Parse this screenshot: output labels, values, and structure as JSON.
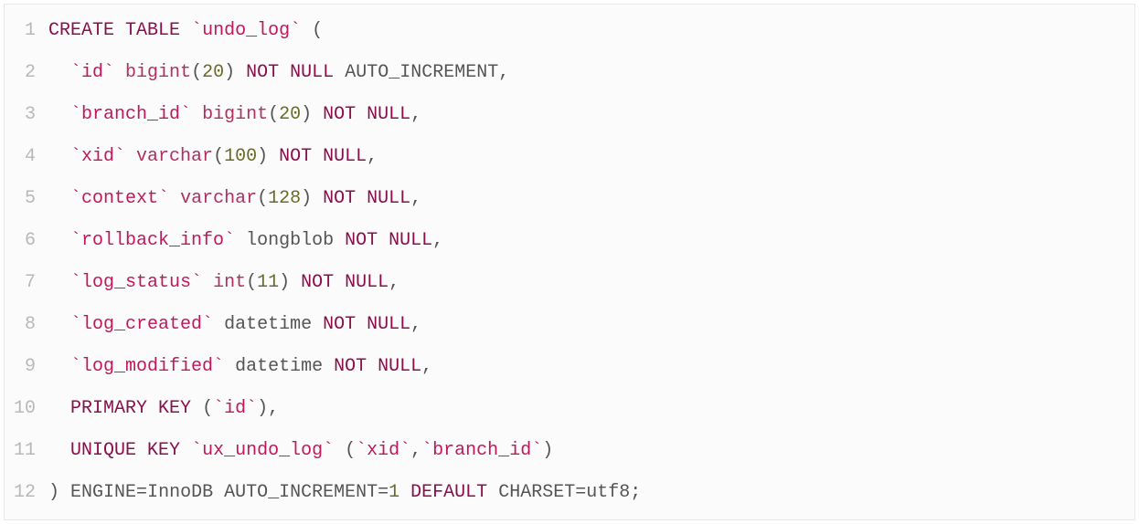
{
  "code": {
    "lines": [
      {
        "n": "1",
        "tokens": [
          [
            "kw",
            "CREATE"
          ],
          [
            "sp",
            " "
          ],
          [
            "kw",
            "TABLE"
          ],
          [
            "sp",
            " "
          ],
          [
            "str",
            "`undo_log`"
          ],
          [
            "sp",
            " "
          ],
          [
            "pun",
            "("
          ]
        ]
      },
      {
        "n": "2",
        "tokens": [
          [
            "sp",
            "  "
          ],
          [
            "str",
            "`id`"
          ],
          [
            "sp",
            " "
          ],
          [
            "type",
            "bigint"
          ],
          [
            "pun",
            "("
          ],
          [
            "num",
            "20"
          ],
          [
            "pun",
            ")"
          ],
          [
            "sp",
            " "
          ],
          [
            "kw",
            "NOT"
          ],
          [
            "sp",
            " "
          ],
          [
            "kw",
            "NULL"
          ],
          [
            "sp",
            " "
          ],
          [
            "id",
            "AUTO_INCREMENT"
          ],
          [
            "pun",
            ","
          ]
        ]
      },
      {
        "n": "3",
        "tokens": [
          [
            "sp",
            "  "
          ],
          [
            "str",
            "`branch_id`"
          ],
          [
            "sp",
            " "
          ],
          [
            "type",
            "bigint"
          ],
          [
            "pun",
            "("
          ],
          [
            "num",
            "20"
          ],
          [
            "pun",
            ")"
          ],
          [
            "sp",
            " "
          ],
          [
            "kw",
            "NOT"
          ],
          [
            "sp",
            " "
          ],
          [
            "kw",
            "NULL"
          ],
          [
            "pun",
            ","
          ]
        ]
      },
      {
        "n": "4",
        "tokens": [
          [
            "sp",
            "  "
          ],
          [
            "str",
            "`xid`"
          ],
          [
            "sp",
            " "
          ],
          [
            "type",
            "varchar"
          ],
          [
            "pun",
            "("
          ],
          [
            "num",
            "100"
          ],
          [
            "pun",
            ")"
          ],
          [
            "sp",
            " "
          ],
          [
            "kw",
            "NOT"
          ],
          [
            "sp",
            " "
          ],
          [
            "kw",
            "NULL"
          ],
          [
            "pun",
            ","
          ]
        ]
      },
      {
        "n": "5",
        "tokens": [
          [
            "sp",
            "  "
          ],
          [
            "str",
            "`context`"
          ],
          [
            "sp",
            " "
          ],
          [
            "type",
            "varchar"
          ],
          [
            "pun",
            "("
          ],
          [
            "num",
            "128"
          ],
          [
            "pun",
            ")"
          ],
          [
            "sp",
            " "
          ],
          [
            "kw",
            "NOT"
          ],
          [
            "sp",
            " "
          ],
          [
            "kw",
            "NULL"
          ],
          [
            "pun",
            ","
          ]
        ]
      },
      {
        "n": "6",
        "tokens": [
          [
            "sp",
            "  "
          ],
          [
            "str",
            "`rollback_info`"
          ],
          [
            "sp",
            " "
          ],
          [
            "id",
            "longblob"
          ],
          [
            "sp",
            " "
          ],
          [
            "kw",
            "NOT"
          ],
          [
            "sp",
            " "
          ],
          [
            "kw",
            "NULL"
          ],
          [
            "pun",
            ","
          ]
        ]
      },
      {
        "n": "7",
        "tokens": [
          [
            "sp",
            "  "
          ],
          [
            "str",
            "`log_status`"
          ],
          [
            "sp",
            " "
          ],
          [
            "type",
            "int"
          ],
          [
            "pun",
            "("
          ],
          [
            "num",
            "11"
          ],
          [
            "pun",
            ")"
          ],
          [
            "sp",
            " "
          ],
          [
            "kw",
            "NOT"
          ],
          [
            "sp",
            " "
          ],
          [
            "kw",
            "NULL"
          ],
          [
            "pun",
            ","
          ]
        ]
      },
      {
        "n": "8",
        "tokens": [
          [
            "sp",
            "  "
          ],
          [
            "str",
            "`log_created`"
          ],
          [
            "sp",
            " "
          ],
          [
            "id",
            "datetime"
          ],
          [
            "sp",
            " "
          ],
          [
            "kw",
            "NOT"
          ],
          [
            "sp",
            " "
          ],
          [
            "kw",
            "NULL"
          ],
          [
            "pun",
            ","
          ]
        ]
      },
      {
        "n": "9",
        "tokens": [
          [
            "sp",
            "  "
          ],
          [
            "str",
            "`log_modified`"
          ],
          [
            "sp",
            " "
          ],
          [
            "id",
            "datetime"
          ],
          [
            "sp",
            " "
          ],
          [
            "kw",
            "NOT"
          ],
          [
            "sp",
            " "
          ],
          [
            "kw",
            "NULL"
          ],
          [
            "pun",
            ","
          ]
        ]
      },
      {
        "n": "10",
        "tokens": [
          [
            "sp",
            "  "
          ],
          [
            "kw",
            "PRIMARY"
          ],
          [
            "sp",
            " "
          ],
          [
            "kw",
            "KEY"
          ],
          [
            "sp",
            " "
          ],
          [
            "pun",
            "("
          ],
          [
            "str",
            "`id`"
          ],
          [
            "pun",
            ")"
          ],
          [
            "pun",
            ","
          ]
        ]
      },
      {
        "n": "11",
        "tokens": [
          [
            "sp",
            "  "
          ],
          [
            "kw",
            "UNIQUE"
          ],
          [
            "sp",
            " "
          ],
          [
            "kw",
            "KEY"
          ],
          [
            "sp",
            " "
          ],
          [
            "str",
            "`ux_undo_log`"
          ],
          [
            "sp",
            " "
          ],
          [
            "pun",
            "("
          ],
          [
            "str",
            "`xid`"
          ],
          [
            "pun",
            ","
          ],
          [
            "str",
            "`branch_id`"
          ],
          [
            "pun",
            ")"
          ]
        ]
      },
      {
        "n": "12",
        "tokens": [
          [
            "pun",
            ")"
          ],
          [
            "sp",
            " "
          ],
          [
            "id",
            "ENGINE"
          ],
          [
            "eq",
            "="
          ],
          [
            "id",
            "InnoDB"
          ],
          [
            "sp",
            " "
          ],
          [
            "id",
            "AUTO_INCREMENT"
          ],
          [
            "eq",
            "="
          ],
          [
            "num",
            "1"
          ],
          [
            "sp",
            " "
          ],
          [
            "kw",
            "DEFAULT"
          ],
          [
            "sp",
            " "
          ],
          [
            "id",
            "CHARSET"
          ],
          [
            "eq",
            "="
          ],
          [
            "id",
            "utf8"
          ],
          [
            "pun",
            ";"
          ]
        ]
      }
    ]
  }
}
